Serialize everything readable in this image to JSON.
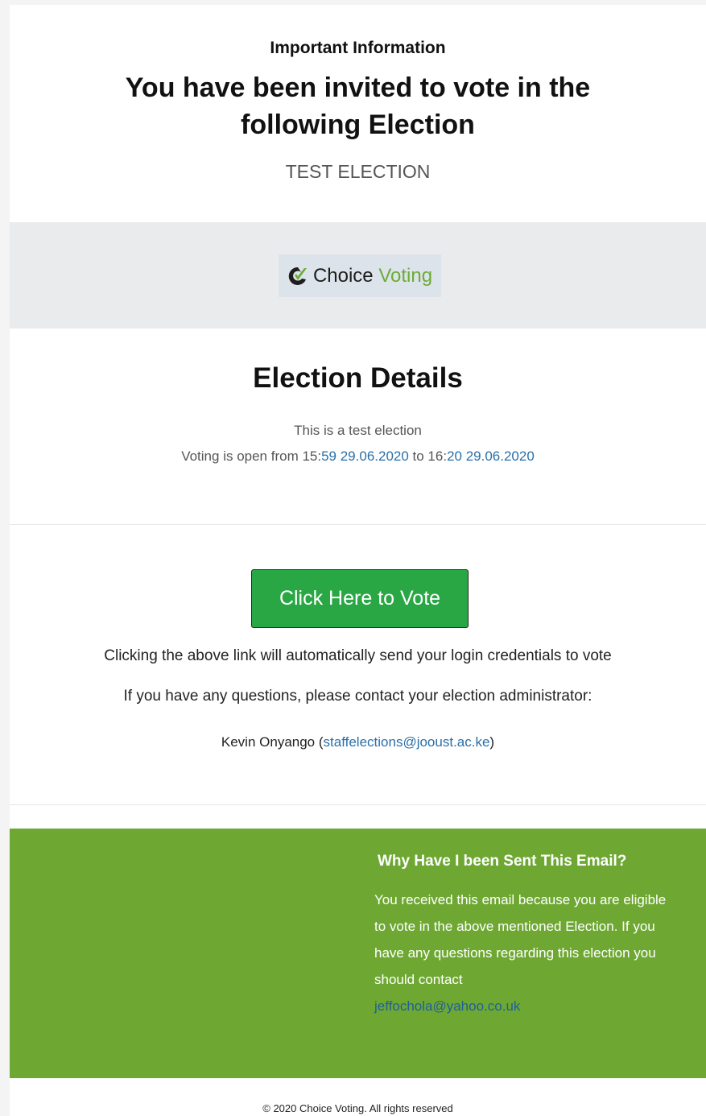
{
  "header": {
    "important": "Important Information",
    "invite_line1": "You have been invited to vote in the",
    "invite_line2": "following Election",
    "election_name": "TEST ELECTION"
  },
  "logo": {
    "choice": "Choice",
    "voting": "Voting",
    "colors": {
      "dark": "#1d1d1b",
      "green": "#6cad34"
    }
  },
  "details": {
    "title": "Election Details",
    "description": "This is a test election",
    "window_prefix": "Voting is open from 15:",
    "window_start": "59 29.06.2020",
    "window_mid": " to 16:",
    "window_end": "20 29.06.2020"
  },
  "vote": {
    "button_label": "Click Here to Vote",
    "note": "Clicking the above link will automatically send your login credentials to vote",
    "questions": "If you have any questions, please contact your election administrator:",
    "admin_name": "Kevin Onyango (",
    "admin_email": "staffelections@jooust.ac.ke",
    "admin_close": ")"
  },
  "why": {
    "title": "Why Have I been Sent This Email?",
    "body": "You received this email because you are eligible to vote in the above mentioned Election. If you have any questions regarding this election you should contact",
    "email": "jeffochola@yahoo.co.uk"
  },
  "footer": {
    "text": "© 2020 Choice Voting. All rights reserved"
  },
  "colors": {
    "button_green": "#29a745",
    "band_green": "#6ea833",
    "link_blue": "#2a6fa8"
  }
}
